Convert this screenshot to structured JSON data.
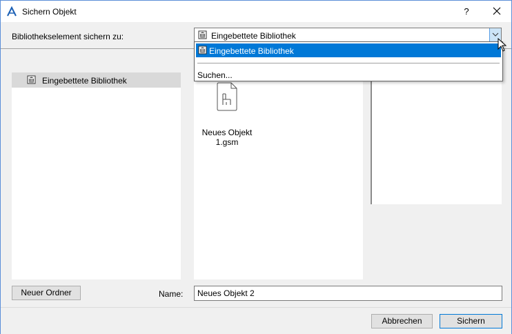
{
  "window": {
    "title": "Sichern Objekt",
    "help_label": "?"
  },
  "save_to": {
    "label": "Bibliothekselement sichern zu:",
    "selected": "Eingebettete Bibliothek"
  },
  "dropdown": {
    "options": [
      "Eingebettete Bibliothek"
    ],
    "search_label": "Suchen..."
  },
  "tree": {
    "items": [
      {
        "label": "Eingebettete Bibliothek"
      }
    ]
  },
  "files": [
    {
      "name_line1": "Neues Objekt",
      "name_line2": "1.gsm"
    }
  ],
  "buttons": {
    "new_folder": "Neuer Ordner",
    "cancel": "Abbrechen",
    "save": "Sichern"
  },
  "name_field": {
    "label": "Name:",
    "value": "Neues Objekt 2"
  },
  "colors": {
    "selection": "#0078d7",
    "combo_button": "#cce4f7",
    "tree_selection": "#d9d9d9"
  }
}
